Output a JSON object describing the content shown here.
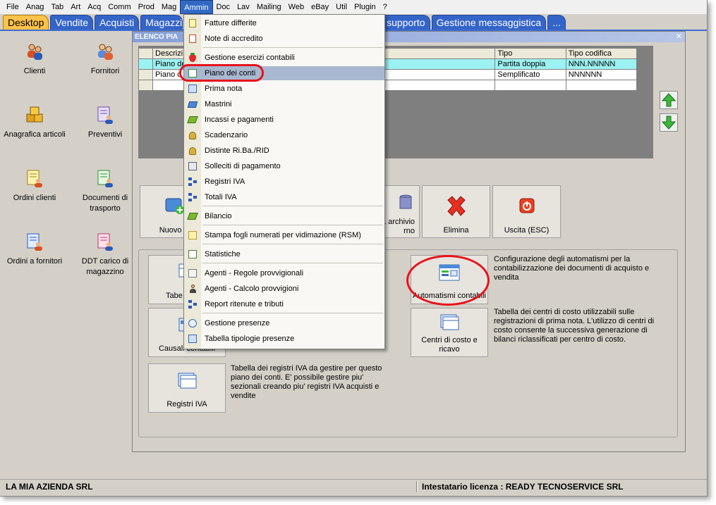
{
  "menubar": {
    "items": [
      "File",
      "Anag",
      "Tab",
      "Art",
      "Acq",
      "Comm",
      "Prod",
      "Mag",
      "Ammin",
      "Doc",
      "Lav",
      "Mailing",
      "Web",
      "eBay",
      "Util",
      "Plugin",
      "?"
    ],
    "active": "Ammin"
  },
  "tabs": {
    "items": [
      "Desktop",
      "Vendite",
      "Acquisti",
      "Magazzin",
      "supporto",
      "Gestione messaggistica",
      "..."
    ]
  },
  "desktop": {
    "clienti": "Clienti",
    "fornitori": "Fornitori",
    "anagrafica_articoli": "Anagrafica articoli",
    "preventivi": "Preventivi",
    "ordini_clienti": "Ordini clienti",
    "documenti_trasporto": "Documenti di trasporto",
    "ordini_fornitori": "Ordini a fornitori",
    "ddt_carico": "DDT carico di magazzino"
  },
  "child": {
    "title": "ELENCO PIA",
    "grid": {
      "headers": {
        "descr": "Descrizi",
        "tipo": "Tipo",
        "codifica": "Tipo codifica"
      },
      "rows": [
        {
          "descr": "Piano de",
          "tipo": "Partita doppia",
          "codifica": "NNN.NNNNN"
        },
        {
          "descr": "Piano d",
          "tipo": "Semplificato",
          "codifica": "NNNNNN"
        }
      ]
    },
    "buttons": {
      "nuovo": "Nuovo (I",
      "archivio_line1": "a archivio",
      "archivio_line2": "rno",
      "elimina": "Elimina",
      "uscita": "Uscita (ESC)"
    },
    "options": {
      "tabelle": "Tabe",
      "causali": "Causali contabili",
      "registri_iva": "Registri IVA",
      "registri_iva_desc": "Tabella dei registri IVA da gestire per questo piano dei conti. E' possibile gestire piu' sezionali creando piu' registri IVA acquisti e vendite",
      "automatismi": "Automatismi contabili",
      "automatismi_desc": "Configurazione degli automatismi per la contabilizzazione dei documenti di acquisto e vendita",
      "centri_line1": "Centri di costo e",
      "centri_line2": "ricavo",
      "centri_desc": "Tabella dei centri di costo utilizzabili sulle registrazioni di prima nota. L'utilizzo di centri di costo consente la successiva generazione di bilanci riclassificati per centro di costo."
    }
  },
  "dropdown": {
    "items": [
      "Fatture differite",
      "Note di accredito",
      "Gestione esercizi contabili",
      "Piano dei conti",
      "Prima nota",
      "Mastrini",
      "Incassi e pagamenti",
      "Scadenzario",
      "Distinte Ri.Ba./RID",
      "Solleciti di pagamento",
      "Registri IVA",
      "Totali IVA",
      "Bilancio",
      "Stampa fogli numerati per vidimazione (RSM)",
      "Statistiche",
      "Agenti - Regole provvigionali",
      "Agenti - Calcolo provvigioni",
      "Report ritenute e tributi",
      "Gestione presenze",
      "Tabella tipologie presenze"
    ],
    "highlighted": "Piano dei conti"
  },
  "status": {
    "left": "LA MIA AZIENDA SRL",
    "right": "Intestatario licenza : READY TECNOSERVICE SRL"
  },
  "colors": {
    "tab_blue": "#3464c8",
    "tab_active": "#ffc24a",
    "selection_row": "#9cf2f2",
    "menu_active": "#316ac5",
    "highlight_ring": "#e8121a"
  }
}
